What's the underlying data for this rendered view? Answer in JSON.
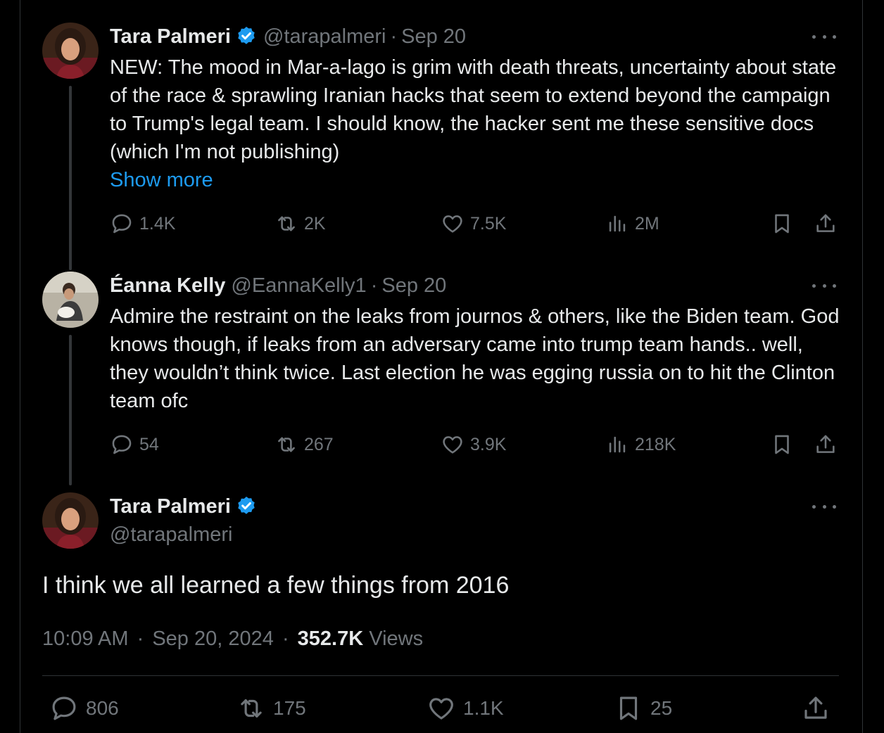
{
  "tweet1": {
    "name": "Tara Palmeri",
    "handle": "@tarapalmeri",
    "date": "Sep 20",
    "text": "NEW: The mood in Mar-a-lago is grim with death threats, uncertainty about state of the race & sprawling Iranian hacks that seem to extend beyond the campaign to Trump's legal team. I should know, the hacker sent me these sensitive docs (which I'm not publishing)",
    "show_more": "Show more",
    "replies": "1.4K",
    "reposts": "2K",
    "likes": "7.5K",
    "views": "2M"
  },
  "tweet2": {
    "name": "Éanna Kelly",
    "handle": "@EannaKelly1",
    "date": "Sep 20",
    "text": "Admire the restraint on the leaks from journos & others, like the Biden team. God knows though, if leaks from an adversary came into trump team hands.. well, they wouldn’t think twice. Last election he was egging russia on to hit the Clinton team ofc",
    "replies": "54",
    "reposts": "267",
    "likes": "3.9K",
    "views": "218K"
  },
  "main": {
    "name": "Tara Palmeri",
    "handle": "@tarapalmeri",
    "text": "I think we all learned a few things from 2016",
    "time": "10:09 AM",
    "date": "Sep 20, 2024",
    "views_count": "352.7K",
    "views_label": "Views",
    "replies": "806",
    "reposts": "175",
    "likes": "1.1K",
    "bookmarks": "25"
  },
  "separator": "·",
  "colors": {
    "background": "#000000",
    "text": "#e7e9ea",
    "muted": "#71767b",
    "link": "#1d9bf0",
    "verified": "#1d9bf0",
    "border": "#2f3336"
  },
  "icons": [
    "reply-icon",
    "repost-icon",
    "like-icon",
    "views-icon",
    "bookmark-icon",
    "share-icon",
    "more-icon",
    "verified-icon"
  ]
}
